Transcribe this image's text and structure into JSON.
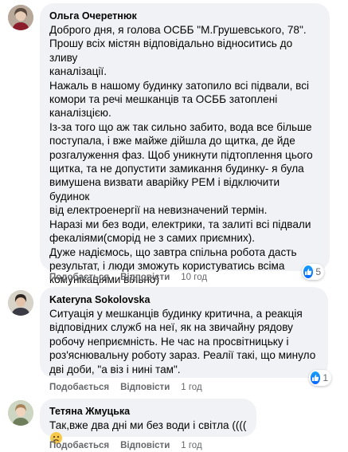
{
  "comments": [
    {
      "author": "Ольга Очеретнюк",
      "lines": [
        "Доброго дня, я голова ОСББ \"М.Грушевського, 78\".",
        "Прошу всіх містян відповідально відноситись до зливу",
        "каналізації.",
        "Нажаль в нашому будинку затопило всі підвали, всі",
        "комори та речі мешканців та ОСББ затоплені",
        "каналізцією.",
        "Із-за того що аж так сильно забито, вода все більше",
        "поступала, і вже майже дійшла до щитка, де йде",
        "розгалуження фаз. Щоб уникнути підтоплення цього",
        "щитка, та не допустити замикання будинку- я була",
        "вимушена визвати аварійку РЕМ і відключити будинок",
        "від електроенергії на невизначений термін.",
        "Наразі ми без води, електрики, та залиті всі підвали",
        "фекаліями(сморід не з самих приємних).",
        "Дуже надіємось, що завтра спільна робота дасть",
        "результат, і люди зможуть користуватись всіма",
        "комунікаціями вільно)"
      ],
      "like_label": "Подобається",
      "reply_label": "Відповісти",
      "time": "10 год",
      "reactions": "5",
      "reaction_icon": "like-icon"
    },
    {
      "author": "Kateryna Sokolovska",
      "lines": [
        "Ситуація у мешканців будинку критична, а реакція",
        "відповідних служб на неї, як на звичайну рядову",
        "робочу неприємність. Не час на просвітницьку і",
        "роз'яснювальну роботу зараз. Реалії такі, що минуло",
        "дві доби, \"а віз і нині там\"."
      ],
      "like_label": "Подобається",
      "reply_label": "Відповісти",
      "time": "1 год",
      "reactions": "1",
      "reaction_icon": "like-icon"
    },
    {
      "author": "Тетяна Жмуцька",
      "text": "Так,вже два дні ми без води і світла ((((",
      "like_label": "Подобається",
      "reply_label": "Відповісти",
      "time": "1 год",
      "text_emoji": "sad-face-emoji"
    }
  ],
  "colors": {
    "bubble": "#f0f2f5",
    "meta_text": "#65676b",
    "like_blue": "#0866ff"
  }
}
